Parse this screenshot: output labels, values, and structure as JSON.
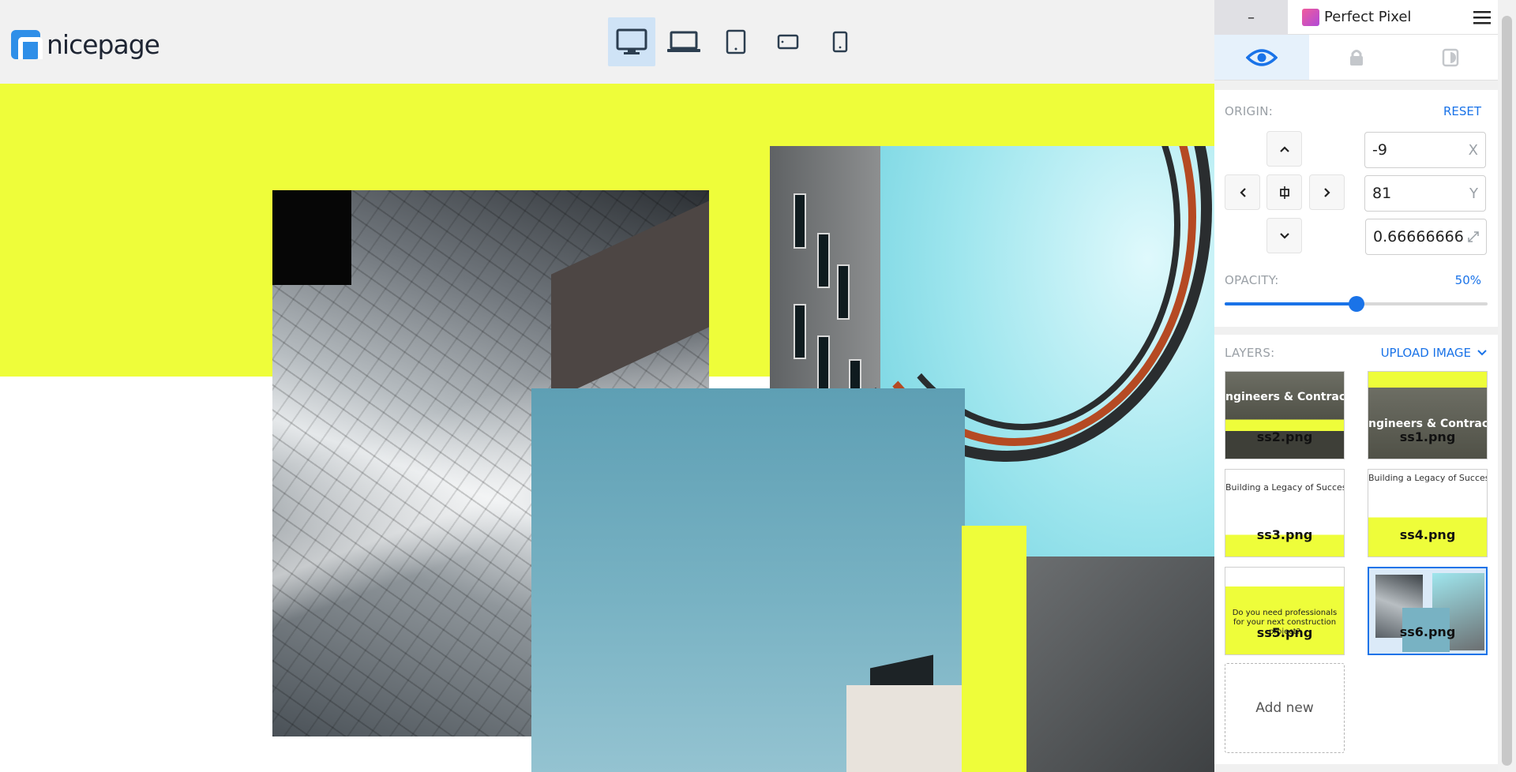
{
  "brand": {
    "name": "nicepage"
  },
  "devices": [
    {
      "name": "desktop",
      "active": true
    },
    {
      "name": "laptop",
      "active": false
    },
    {
      "name": "tablet",
      "active": false
    },
    {
      "name": "phone-landscape",
      "active": false
    },
    {
      "name": "phone",
      "active": false
    }
  ],
  "plugin": {
    "title": "Perfect Pixel",
    "minimize_label": "–",
    "origin": {
      "label": "ORIGIN:",
      "reset_label": "RESET",
      "x_value": "-9",
      "x_suffix": "X",
      "y_value": "81",
      "y_suffix": "Y",
      "scale_value": "0.66666666"
    },
    "opacity": {
      "label": "OPACITY:",
      "value_text": "50%",
      "value": 0.5
    },
    "layers": {
      "label": "LAYERS:",
      "upload_label": "UPLOAD IMAGE",
      "items": [
        {
          "name": "ss2.png",
          "caption": "ngineers & Contractor",
          "active": false
        },
        {
          "name": "ss1.png",
          "caption": "ngineers & Contractor",
          "active": false
        },
        {
          "name": "ss3.png",
          "caption": "Building a Legacy of Success",
          "active": false
        },
        {
          "name": "ss4.png",
          "caption": "Building a Legacy of Success",
          "active": false
        },
        {
          "name": "ss5.png",
          "caption": "Do you need professionals for your next construction project?",
          "active": false
        },
        {
          "name": "ss6.png",
          "caption": "",
          "active": true
        }
      ],
      "add_new_label": "Add new"
    }
  },
  "colors": {
    "accent": "#1a73e8",
    "yellow": "#eefd3a",
    "logo_blue": "#2f8fe8"
  }
}
